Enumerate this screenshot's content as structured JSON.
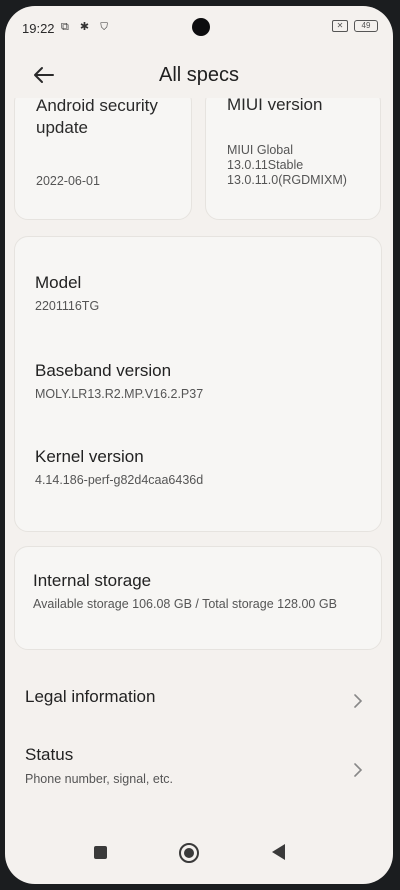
{
  "status_bar": {
    "time": "19:22",
    "icons": "⧉ ✱ ⛉",
    "sim": "✕",
    "battery": "49"
  },
  "header": {
    "title": "All specs"
  },
  "security_card": {
    "title": "Android security update",
    "value": "2022-06-01"
  },
  "miui_card": {
    "title": "MIUI version",
    "value_line1": "MIUI Global",
    "value_line2": "13.0.11Stable",
    "value_line3": "13.0.11.0(RGDMIXM)"
  },
  "device": {
    "model_title": "Model",
    "model_value": "2201116TG",
    "baseband_title": "Baseband version",
    "baseband_value": "MOLY.LR13.R2.MP.V16.2.P37",
    "kernel_title": "Kernel version",
    "kernel_value": "4.14.186-perf-g82d4caa6436d"
  },
  "storage": {
    "title": "Internal storage",
    "value": "Available storage 106.08 GB / Total storage 128.00 GB"
  },
  "legal": {
    "title": "Legal information"
  },
  "status": {
    "title": "Status",
    "subtitle": "Phone number, signal, etc."
  },
  "colors": {
    "background": "#f4f1ee",
    "card": "#f7f6f4",
    "text_primary": "#222222",
    "text_secondary": "#555555"
  }
}
